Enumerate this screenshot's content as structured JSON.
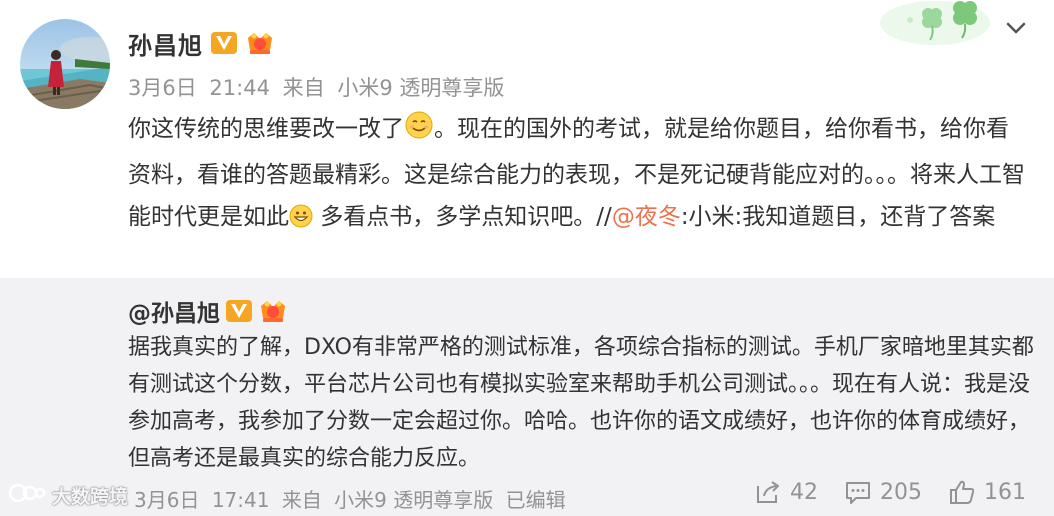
{
  "post": {
    "author": "孙昌旭",
    "date": "3月6日",
    "time": "21:44",
    "source_prefix": "来自",
    "source": "小米9 透明尊享版",
    "text_1": "你这传统的思维要改一改了",
    "text_2": "。现在的国外的考试，就是给你题目，给你看书，给你看资料，看谁的答题最精彩。这是综合能力的表现，不是死记硬背能应对的。。。将来人工智能时代更是如此",
    "text_3": " 多看点书，多学点知识吧。//",
    "mention": "@夜冬",
    "text_4": ":小米:我知道题目，还背了答案"
  },
  "repost": {
    "author": "@孙昌旭",
    "text": "据我真实的了解，DXO有非常严格的测试标准，各项综合指标的测试。手机厂家暗地里其实都有测试这个分数，平台芯片公司也有模拟实验室来帮助手机公司测试。。。现在有人说：我是没参加高考，我参加了分数一定会超过你。哈哈。也许你的语文成绩好，也许你的体育成绩好，但高考还是最真实的综合能力反应。",
    "date": "3月6日",
    "time": "17:41",
    "source_prefix": "来自",
    "source": "小米9 透明尊享版",
    "edited": "已编辑",
    "repost_count": "42",
    "comment_count": "205",
    "like_count": "161"
  },
  "watermark": "大数跨境",
  "colors": {
    "mention": "#eb7350",
    "meta_gray": "#939393",
    "repost_bg": "#f2f2f5",
    "verified_orange": "#f5a623"
  },
  "icons": [
    "avatar",
    "verified-v-icon",
    "member-crown-icon",
    "clover-decoration",
    "chevron-down-icon",
    "smile-emoji",
    "grin-emoji",
    "repost-icon",
    "comment-icon",
    "like-icon",
    "watermark-logo-icon"
  ]
}
